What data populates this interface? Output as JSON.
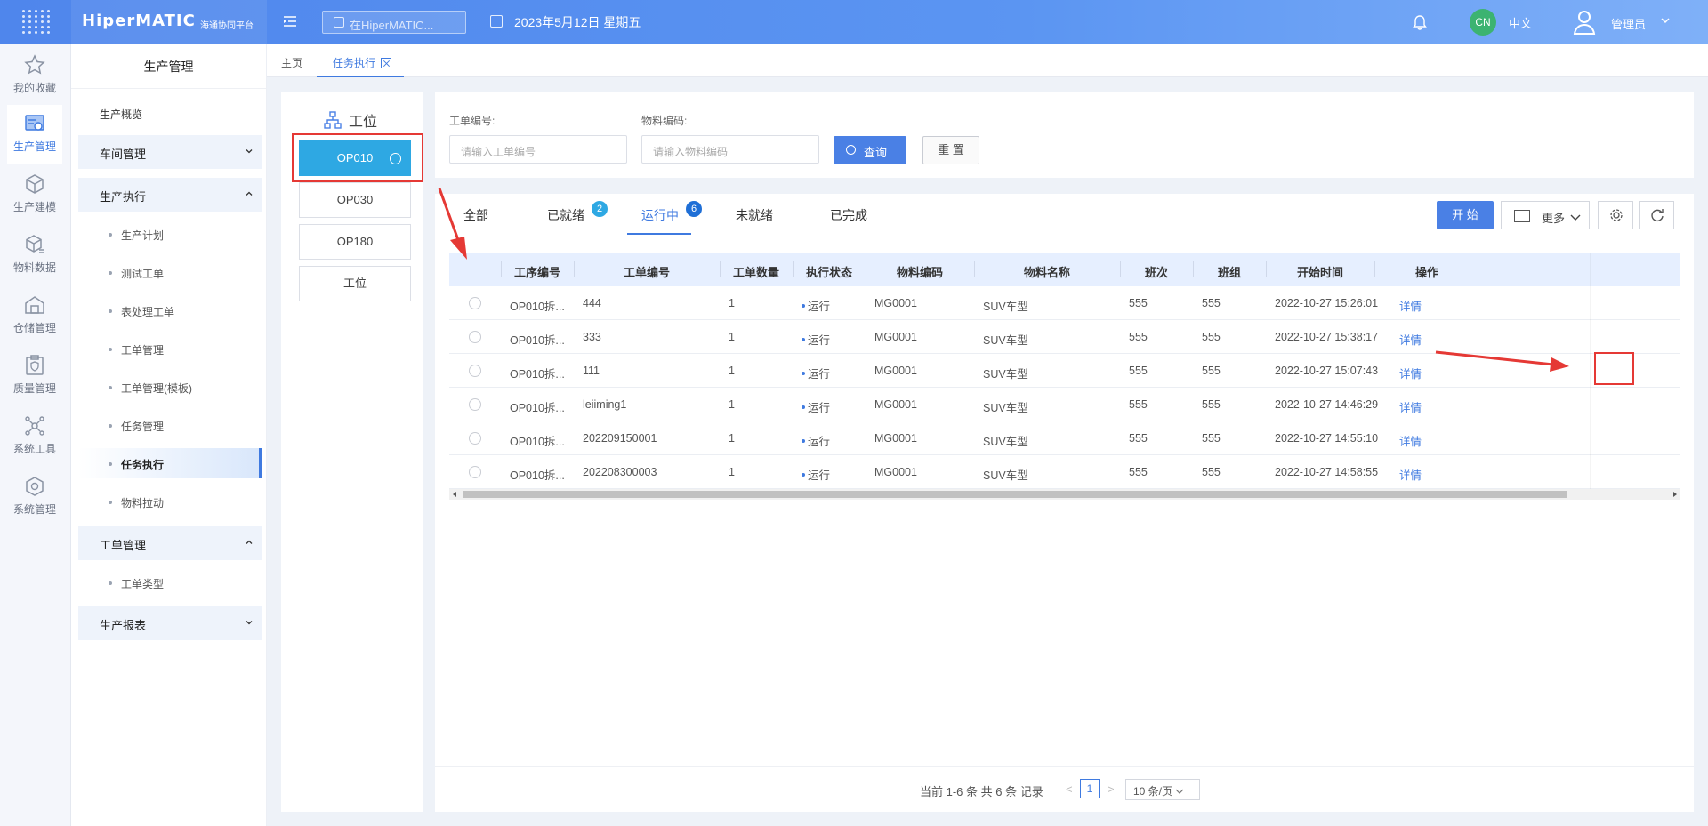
{
  "header": {
    "logo": "HiperMATIC",
    "logo_sub": "海通协同平台",
    "search_placeholder": "在HiperMATIC...",
    "date": "2023年5月12日 星期五",
    "lang_badge": "CN",
    "lang": "中文",
    "user": "管理员"
  },
  "rail": [
    {
      "label": "我的收藏",
      "icon": "star-icon"
    },
    {
      "label": "生产管理",
      "icon": "production-icon"
    },
    {
      "label": "生产建模",
      "icon": "cube-icon"
    },
    {
      "label": "物料数据",
      "icon": "cube-list-icon"
    },
    {
      "label": "仓储管理",
      "icon": "warehouse-icon"
    },
    {
      "label": "质量管理",
      "icon": "clipboard-shield-icon"
    },
    {
      "label": "系统工具",
      "icon": "network-icon"
    },
    {
      "label": "系统管理",
      "icon": "cube-gear-icon"
    }
  ],
  "subnav": {
    "title": "生产管理",
    "overview": "生产概览",
    "groups": {
      "workshop": "车间管理",
      "execution": "生产执行",
      "workorder": "工单管理",
      "report": "生产报表"
    },
    "execution_items": [
      "生产计划",
      "测试工单",
      "表处理工单",
      "工单管理",
      "工单管理(模板)",
      "任务管理",
      "任务执行",
      "物料拉动"
    ],
    "workorder_items": [
      "工单类型"
    ]
  },
  "breadcrumb": {
    "home": "主页",
    "current_tab": "任务执行"
  },
  "stations": {
    "title": "工位",
    "items": [
      "OP010",
      "OP030",
      "OP180",
      "工位"
    ]
  },
  "filter": {
    "order_label": "工单编号:",
    "order_placeholder": "请输入工单编号",
    "material_label": "物料编码:",
    "material_placeholder": "请输入物料编码",
    "query": "查询",
    "reset": "重 置"
  },
  "tabs": [
    {
      "label": "全部"
    },
    {
      "label": "已就绪",
      "badge": "2"
    },
    {
      "label": "运行中",
      "badge": "6"
    },
    {
      "label": "未就绪"
    },
    {
      "label": "已完成"
    }
  ],
  "toolbar": {
    "start": "开 始",
    "more": "更多"
  },
  "table": {
    "headers": [
      "工序编号",
      "工单编号",
      "工单数量",
      "执行状态",
      "物料编码",
      "物料名称",
      "班次",
      "班组",
      "开始时间",
      "操作"
    ],
    "rows": [
      [
        "OP010拆...",
        "444",
        "1",
        "运行",
        "MG0001",
        "SUV车型",
        "555",
        "555",
        "2022-10-27 15:26:01",
        "详情"
      ],
      [
        "OP010拆...",
        "333",
        "1",
        "运行",
        "MG0001",
        "SUV车型",
        "555",
        "555",
        "2022-10-27 15:38:17",
        "详情"
      ],
      [
        "OP010拆...",
        "111",
        "1",
        "运行",
        "MG0001",
        "SUV车型",
        "555",
        "555",
        "2022-10-27 15:07:43",
        "详情"
      ],
      [
        "OP010拆...",
        "leiiming1",
        "1",
        "运行",
        "MG0001",
        "SUV车型",
        "555",
        "555",
        "2022-10-27 14:46:29",
        "详情"
      ],
      [
        "OP010拆...",
        "202209150001",
        "1",
        "运行",
        "MG0001",
        "SUV车型",
        "555",
        "555",
        "2022-10-27 14:55:10",
        "详情"
      ],
      [
        "OP010拆...",
        "202208300003",
        "1",
        "运行",
        "MG0001",
        "SUV车型",
        "555",
        "555",
        "2022-10-27 14:58:55",
        "详情"
      ]
    ]
  },
  "pager": {
    "summary": "当前 1-6 条 共 6 条 记录",
    "page": "1",
    "size": "10 条/页"
  },
  "colors": {
    "accent": "#3f7ae0",
    "station_active": "#2ea8e3",
    "annotation_red": "#e53935"
  }
}
